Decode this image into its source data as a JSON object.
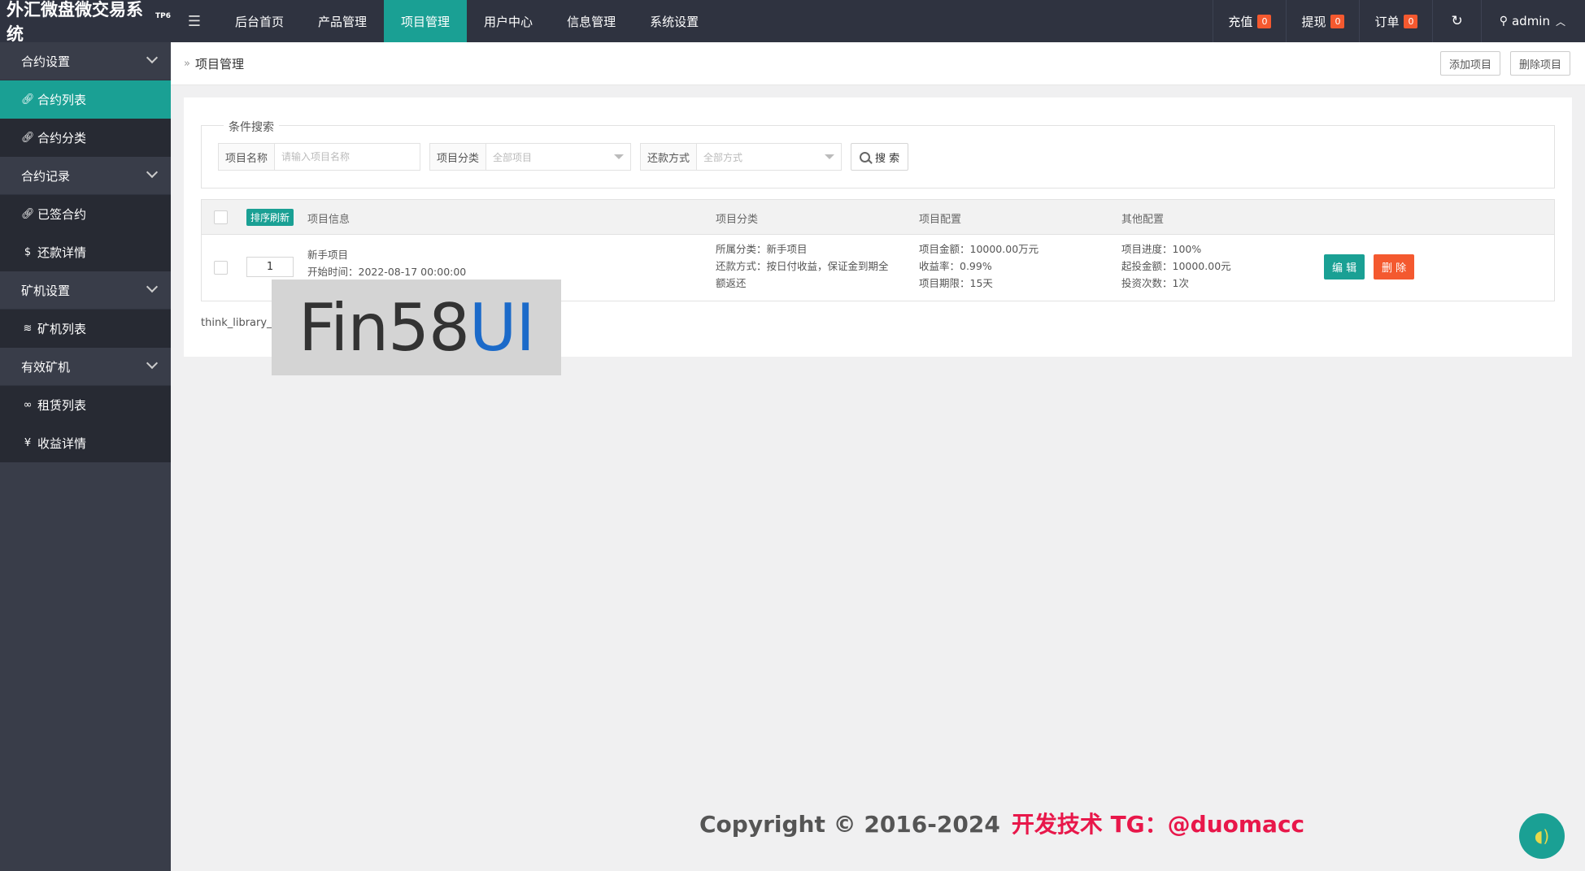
{
  "header": {
    "brand": "外汇微盘微交易系统",
    "brand_sup": "TP6",
    "menu_icon": "hamburger-icon",
    "nav": [
      "后台首页",
      "产品管理",
      "项目管理",
      "用户中心",
      "信息管理",
      "系统设置"
    ],
    "active_nav": "项目管理",
    "recharge_label": "充值",
    "recharge_count": "0",
    "withdraw_label": "提现",
    "withdraw_count": "0",
    "order_label": "订单",
    "order_count": "0",
    "user": "admin"
  },
  "sidebar": {
    "group1": "合约设置",
    "item_contract_list": "合约列表",
    "item_contract_category": "合约分类",
    "group2": "合约记录",
    "item_signed": "已签合约",
    "item_repay": "还款详情",
    "group3": "矿机设置",
    "item_miner_list": "矿机列表",
    "group4": "有效矿机",
    "item_rent_list": "租赁列表",
    "item_income": "收益详情"
  },
  "breadcrumb": "项目管理",
  "actions": {
    "add": "添加项目",
    "delete": "删除项目"
  },
  "search": {
    "legend": "条件搜索",
    "name_label": "项目名称",
    "name_placeholder": "请输入项目名称",
    "category_label": "项目分类",
    "category_value": "全部项目",
    "repay_label": "还款方式",
    "repay_value": "全部方式",
    "button": "搜 索"
  },
  "table": {
    "sort_button": "排序刷新",
    "col_info": "项目信息",
    "col_category": "项目分类",
    "col_config": "项目配置",
    "col_other": "其他配置",
    "row": {
      "sort": "1",
      "name": "新手项目",
      "start": "开始时间：2022-08-17 00:00:00",
      "category": "所属分类：新手项目",
      "repay_line1": "还款方式：按日付收益，保证金到期全",
      "repay_line2": "额返还",
      "amount": "项目金额：10000.00万元",
      "rate": "收益率：0.99%",
      "term": "项目期限：15天",
      "progress": "项目进度：100%",
      "min_invest": "起投金额：10000.00元",
      "invest_times": "投资次数：1次",
      "edit": "编 辑",
      "delete": "删 除"
    }
  },
  "page_text": "think_library_p",
  "watermark": {
    "part1": "Fin58",
    "part2": "UI"
  },
  "copyright": {
    "text": "Copyright © 2016-2024",
    "highlight": "开发技术 TG：@duomacc"
  }
}
